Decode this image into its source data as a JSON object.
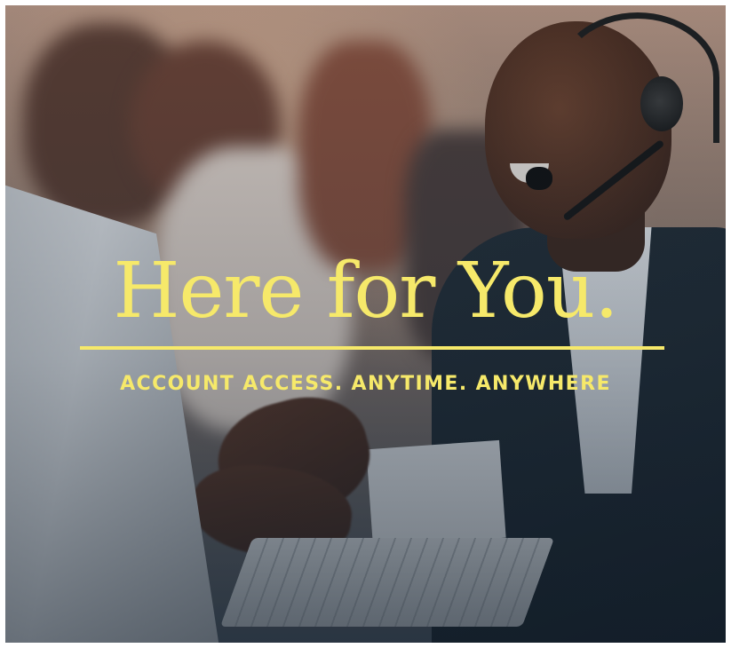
{
  "banner": {
    "headline": "Here for You.",
    "tagline": "ACCOUNT ACCESS. ANYTIME. ANYWHERE",
    "photo": {
      "subject": "customer-support-agent-with-headset"
    }
  },
  "colors": {
    "accent_text": "#f6e96a",
    "overlay_tint": "#2a3c48",
    "frame": "#ffffff"
  }
}
